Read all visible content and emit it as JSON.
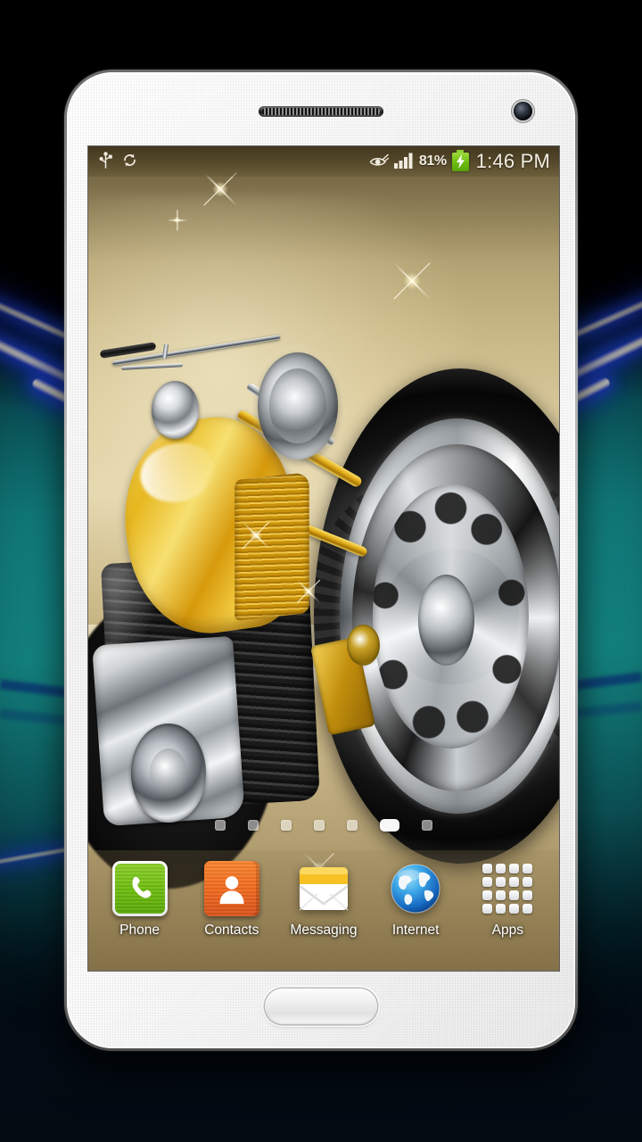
{
  "wallpaper": {
    "subject": "gold-chrome-motorcycle",
    "scene_colors": {
      "gold": "#e8b821",
      "chrome": "#cfd3d6",
      "background_gold": "#c6b584"
    },
    "sparkles": 6
  },
  "backdrop": {
    "theme": "neon-tunnel",
    "colors": {
      "teal": "#17a0a2",
      "neon_blue": "#2846ff",
      "dark": "#05080c"
    }
  },
  "device": {
    "frame": "white-smartphone",
    "speaker_name": "earpiece-speaker",
    "camera_name": "front-camera",
    "home_button_name": "home-button"
  },
  "status_bar": {
    "left_icons": [
      {
        "name": "usb-icon",
        "label": "USB connected"
      },
      {
        "name": "sync-icon",
        "label": "Sync active"
      }
    ],
    "right_icons": [
      {
        "name": "smart-stay-eye-icon",
        "label": "Smart stay"
      },
      {
        "name": "signal-bars-icon",
        "label": "Signal strength",
        "bars": 4
      }
    ],
    "battery_percent": "81%",
    "battery_state": "charging",
    "clock": "1:46 PM"
  },
  "home_screen": {
    "page_indicator": {
      "total": 7,
      "active_index": 5
    }
  },
  "dock": {
    "items": [
      {
        "label": "Phone",
        "icon": "phone-handset-icon",
        "color": "#6fbd10"
      },
      {
        "label": "Contacts",
        "icon": "contacts-person-icon",
        "color": "#f06a1e"
      },
      {
        "label": "Messaging",
        "icon": "envelope-icon",
        "color": "#f5c02a"
      },
      {
        "label": "Internet",
        "icon": "globe-icon",
        "color": "#2f9fe0"
      },
      {
        "label": "Apps",
        "icon": "apps-grid-icon",
        "color": "#ffffff"
      }
    ]
  }
}
